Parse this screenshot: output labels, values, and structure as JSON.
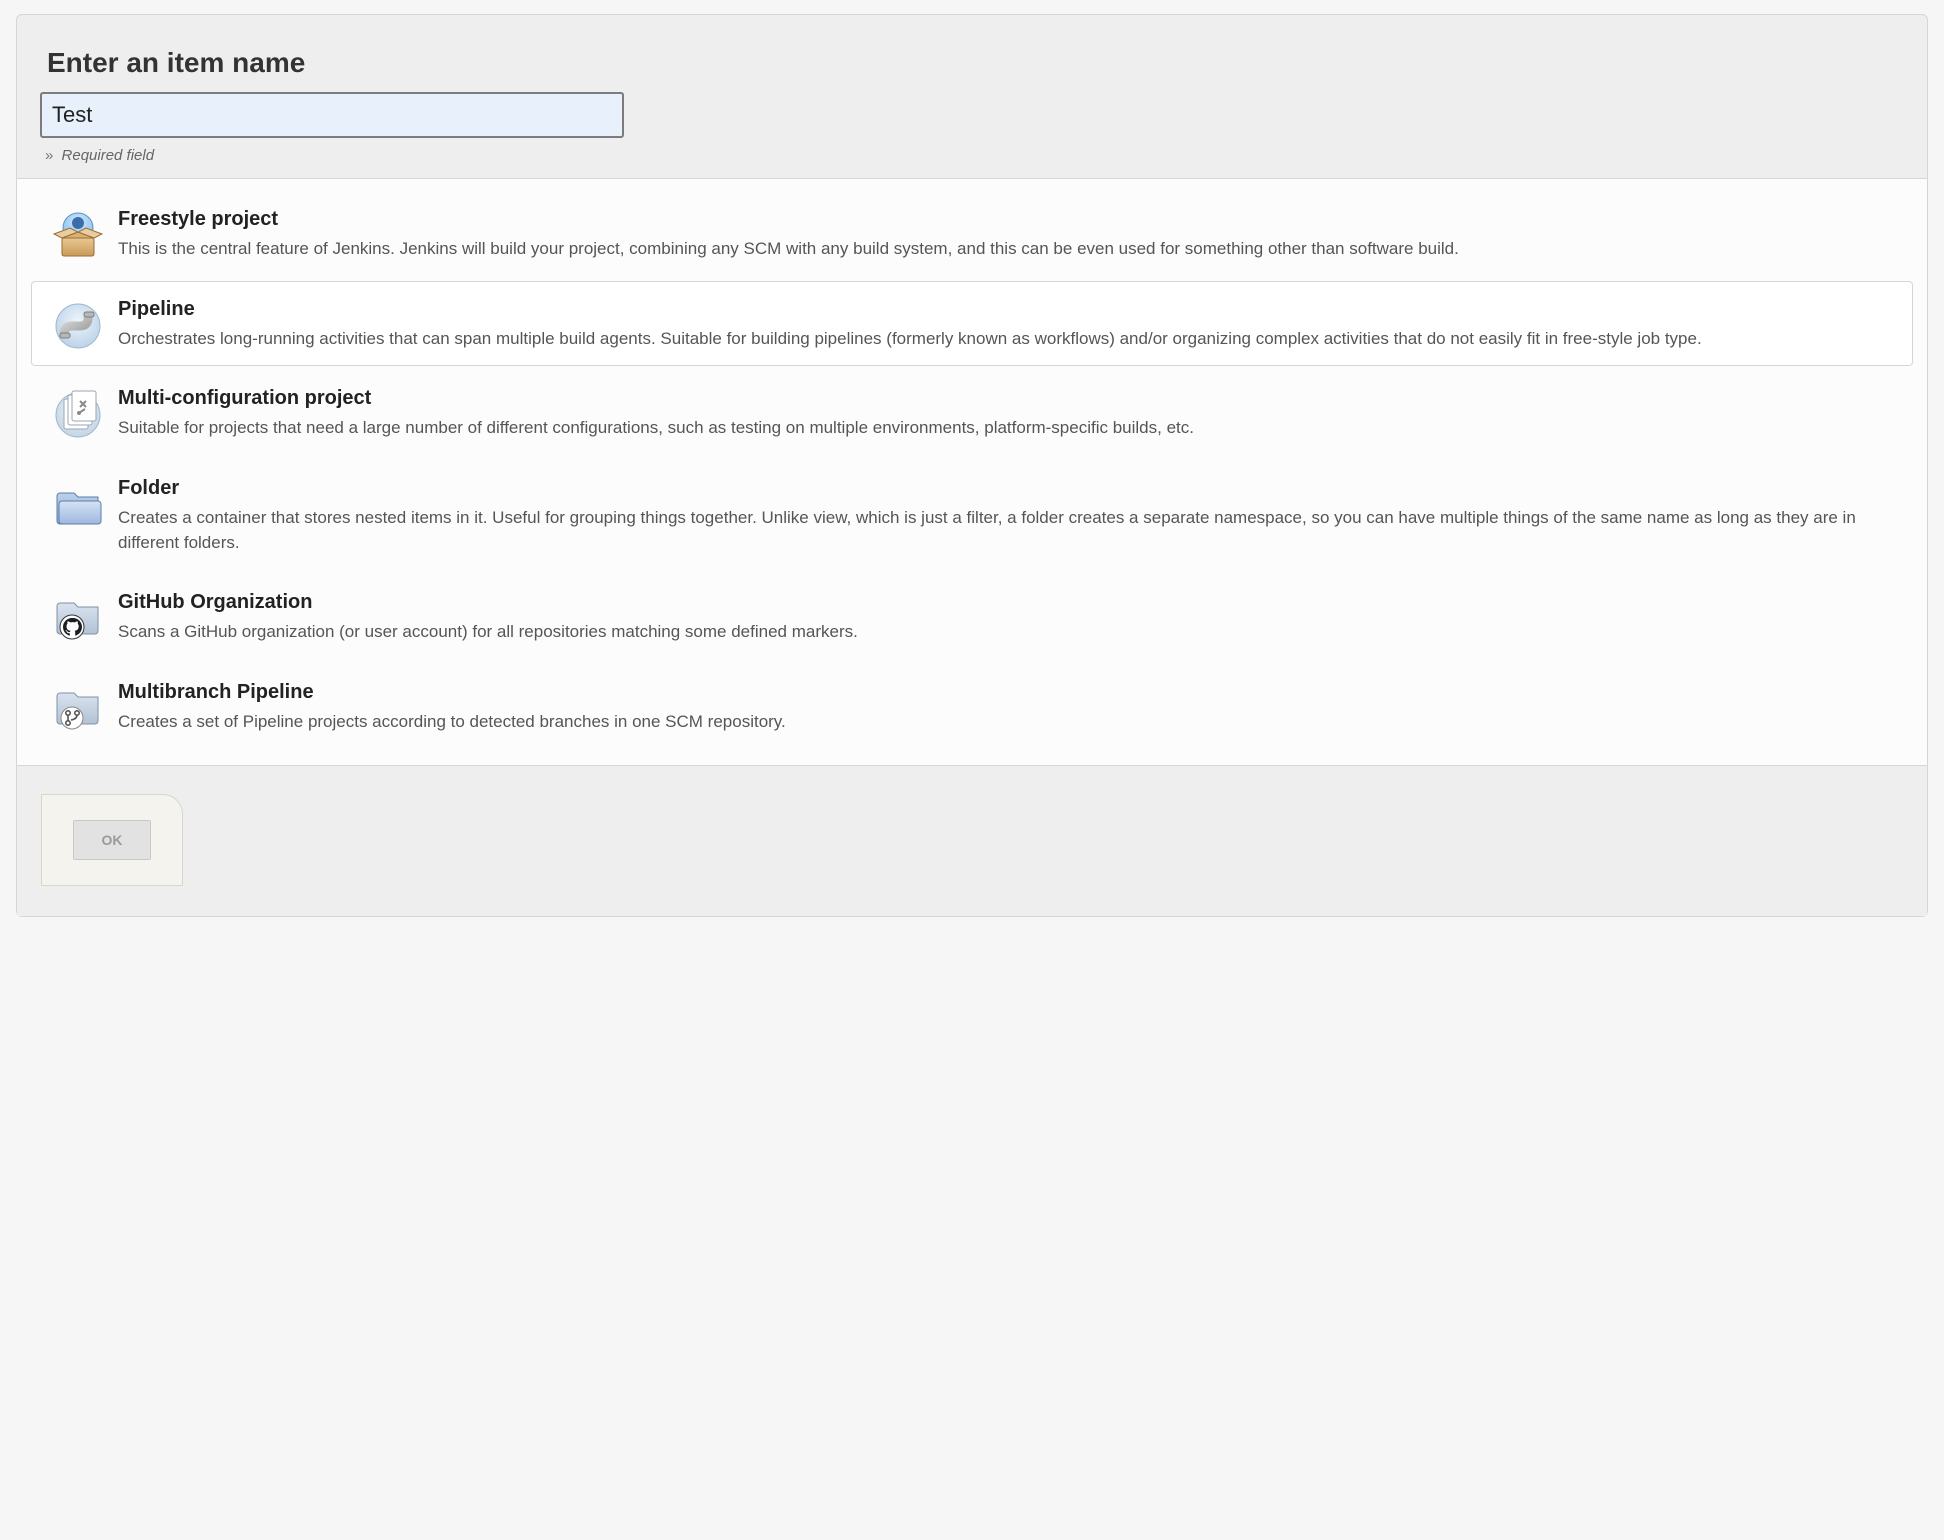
{
  "header": {
    "title": "Enter an item name",
    "name_input_value": "Test",
    "hint_prefix": "»",
    "hint_text": "Required field"
  },
  "item_types": [
    {
      "id": "freestyle",
      "title": "Freestyle project",
      "desc": "This is the central feature of Jenkins. Jenkins will build your project, combining any SCM with any build system, and this can be even used for something other than software build.",
      "selected": false
    },
    {
      "id": "pipeline",
      "title": "Pipeline",
      "desc": "Orchestrates long-running activities that can span multiple build agents. Suitable for building pipelines (formerly known as workflows) and/or organizing complex activities that do not easily fit in free-style job type.",
      "selected": true
    },
    {
      "id": "multiconfig",
      "title": "Multi-configuration project",
      "desc": "Suitable for projects that need a large number of different configurations, such as testing on multiple environments, platform-specific builds, etc.",
      "selected": false
    },
    {
      "id": "folder",
      "title": "Folder",
      "desc": "Creates a container that stores nested items in it. Useful for grouping things together. Unlike view, which is just a filter, a folder creates a separate namespace, so you can have multiple things of the same name as long as they are in different folders.",
      "selected": false
    },
    {
      "id": "github-org",
      "title": "GitHub Organization",
      "desc": "Scans a GitHub organization (or user account) for all repositories matching some defined markers.",
      "selected": false
    },
    {
      "id": "multibranch",
      "title": "Multibranch Pipeline",
      "desc": "Creates a set of Pipeline projects according to detected branches in one SCM repository.",
      "selected": false
    }
  ],
  "footer": {
    "ok_label": "OK"
  }
}
